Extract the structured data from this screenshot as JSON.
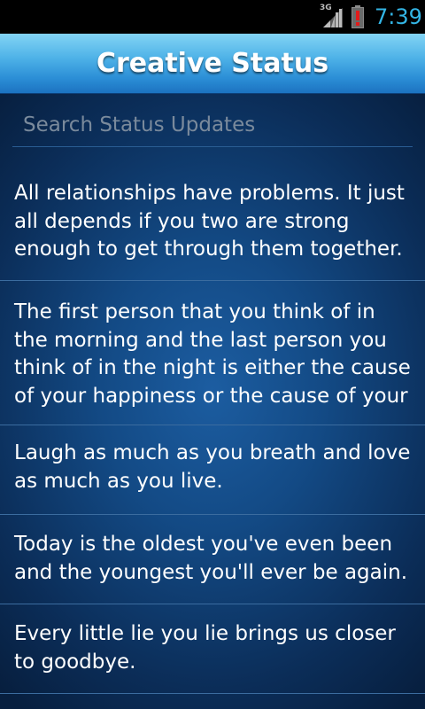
{
  "status_bar": {
    "network_label": "3G",
    "time": "7:39",
    "time_color": "#33b5e5",
    "icons": [
      "signal-icon",
      "battery-alert-icon"
    ]
  },
  "header": {
    "title": "Creative Status"
  },
  "search": {
    "placeholder": "Search Status Updates",
    "value": ""
  },
  "statuses": [
    {
      "text": "All relationships have problems. It just all depends if you two are strong enough to get through them together."
    },
    {
      "text": "The first person that you think of in the morning and the last person you think of in the night is either the cause of your happiness or the cause of your"
    },
    {
      "text": "Laugh as much as you breath and love as much as you live."
    },
    {
      "text": "Today is the oldest you've even been and the youngest you'll ever be again."
    },
    {
      "text": "Every little lie you lie brings us closer to goodbye."
    }
  ],
  "colors": {
    "header_gradient_top": "#83d4f4",
    "header_gradient_bottom": "#1c73c1",
    "background_center": "#1c5da1",
    "background_edge": "#071f3f",
    "divider": "#3b6c9f"
  }
}
